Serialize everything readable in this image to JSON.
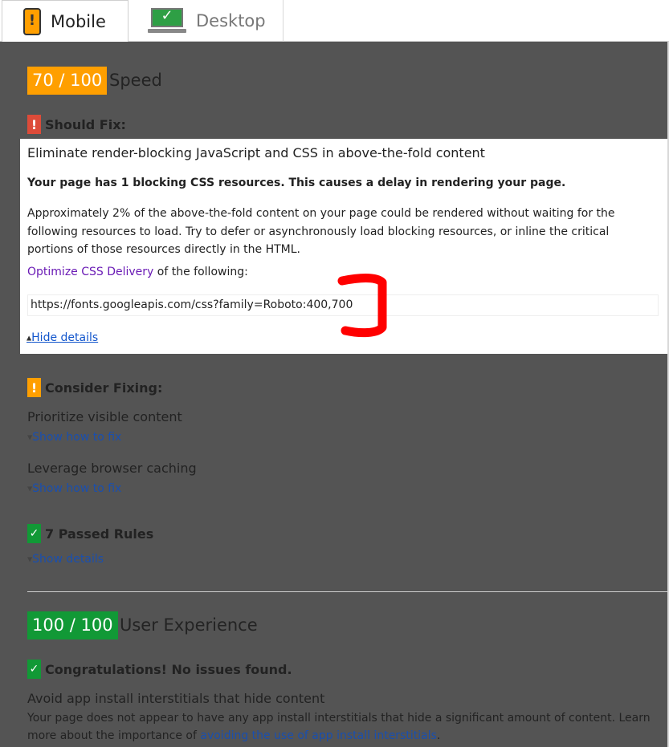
{
  "tabs": [
    {
      "label": "Mobile",
      "icon": "phone-icon",
      "selected": true
    },
    {
      "label": "Desktop",
      "icon": "monitor-icon",
      "selected": false
    }
  ],
  "speed": {
    "score": "70 / 100",
    "title": "Speed",
    "color": "#ff9f00"
  },
  "should_fix": {
    "heading": "Should Fix:",
    "rule": {
      "title": "Eliminate render-blocking JavaScript and CSS in above-the-fold content",
      "summary": "Your page has 1 blocking CSS resources. This causes a delay in rendering your page.",
      "description": "Approximately 2% of the above-the-fold content on your page could be rendered without waiting for the following resources to load. Try to defer or asynchronously load blocking resources, or inline the critical portions of those resources directly in the HTML.",
      "optimize_link": "Optimize CSS Delivery",
      "optimize_suffix": " of the following:",
      "resources": [
        "https://fonts.googleapis.com/css?family=Roboto:400,700"
      ],
      "toggle": "Hide details"
    }
  },
  "consider_fixing": {
    "heading": "Consider Fixing:",
    "rules": [
      {
        "title": "Prioritize visible content",
        "link": "Show how to fix"
      },
      {
        "title": "Leverage browser caching",
        "link": "Show how to fix"
      }
    ]
  },
  "passed": {
    "heading": "7 Passed Rules",
    "link": "Show details"
  },
  "user_experience": {
    "score": "100 / 100",
    "title": "User Experience",
    "color": "#119936",
    "heading": "Congratulations! No issues found.",
    "rule_title": "Avoid app install interstitials that hide content",
    "text_before": "Your page does not appear to have any app install interstitials that hide a significant amount of content. Learn more about the importance of ",
    "link": "avoiding the use of app install interstitials",
    "text_after": "."
  },
  "colors": {
    "overlay": "#545454",
    "link": "#1155cc",
    "visited_link": "#6a1bb5",
    "annotation": "#ff0000"
  }
}
